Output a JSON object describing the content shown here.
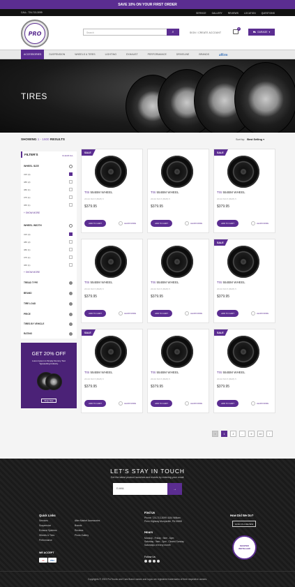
{
  "promo": {
    "text": "SAVE 10% ON YOUR FIRST ORDER"
  },
  "topbar": {
    "phone": "CALL: 724-713-3099",
    "links": [
      "SERVICE",
      "GALLERY",
      "REVIEWS",
      "LOCATION",
      "QUESTIONS"
    ]
  },
  "header": {
    "logo_text": "PRO",
    "search_placeholder": "Search",
    "signin_text": "SIGN / CREATE ACCOUNT",
    "cart_count": "0",
    "garage_label": "GARAGE"
  },
  "nav": {
    "items": [
      "ACCESSORIES",
      "SUSPENSION",
      "WHEELS & TIRES",
      "LIGHTING",
      "EXHAUST",
      "PERFORMANCE",
      "DRIVELINE",
      "BRANDS"
    ],
    "affirm": "affirm"
  },
  "hero": {
    "title": "TIRES"
  },
  "results": {
    "prefix": "SHOWING",
    "range": "1 - 1600",
    "suffix": "RESULTS"
  },
  "sort": {
    "label": "Sort by:",
    "value": "Best Selling"
  },
  "filters": {
    "title": "FILTER'S",
    "clear": "CLEAR ALL",
    "wheel_size": {
      "title": "WHEEL SIZE",
      "options": [
        "315 (4)",
        "385 (2)",
        "380 (1)",
        "375 (1)",
        "365 (1)"
      ],
      "more": "+ SHOW MORE"
    },
    "wheel_width": {
      "title": "WHEEL WIDTH",
      "options": [
        "315 (4)",
        "385 (2)",
        "380 (1)",
        "375 (1)",
        "365 (1)"
      ],
      "more": "+ SHOW MORE"
    },
    "collapsed": [
      "TREAD TYPE",
      "BRAND",
      "TIRE LOAD",
      "PRICE",
      "TIRES BY VEHICLE",
      "RATING"
    ]
  },
  "ad": {
    "title": "GET 20% OFF",
    "text": "Lorem Ipsum is Simply Dummy Text Typesetting Industry.",
    "button": "Shop Now"
  },
  "product": {
    "brand": "TIS",
    "model": "554BM WHEEL",
    "spec": "20x10 8x6.5 (BHB) 5",
    "price": "$379.95",
    "add_label": "ADD TO CART",
    "learn_label": "LEARN MORE",
    "sale_label": "SALE"
  },
  "pagination": [
    "‹",
    "1",
    "2",
    "...",
    "9",
    "10",
    "›"
  ],
  "footer": {
    "title": "LET'S STAY IN TOUCH",
    "subtitle": "Get the latest product launches and events by entering your email.",
    "email_placeholder": "E-MAIL",
    "quick_links_title": "Quick Links",
    "quick_links_col1": [
      "Services",
      "Suspension",
      "Exhaust Systems",
      "Wheels & Tires",
      "Performance"
    ],
    "quick_links_col2": [
      "After Market Accessories",
      "Brands",
      "Reviews",
      "Photo Gallery"
    ],
    "we_accept": "WE ACCEPT",
    "find_us_title": "Find Us",
    "phone": "Phone: 724-713-3099 ",
    "address_1": "4184 William",
    "address_2": "Penn Highway Murrysville, PA 15668",
    "hours_title": "Hours",
    "hours_1": "Monday - Friday : 9am - 6pm",
    "hours_2": "Saturday : 9am - 2pm , Closed Sunday",
    "hours_3": "Saturdays of every month",
    "follow_title": "Follow Us",
    "how_title": "How Did We Do?",
    "review_btn": "GIVE US A REVIEW",
    "badge_1": "MASTER",
    "badge_2": "INSTALLER",
    "copyright": "Copyrights © 2023 ProTrucks and Cars Brand names and logos are registered trademarks of their respective owners."
  }
}
